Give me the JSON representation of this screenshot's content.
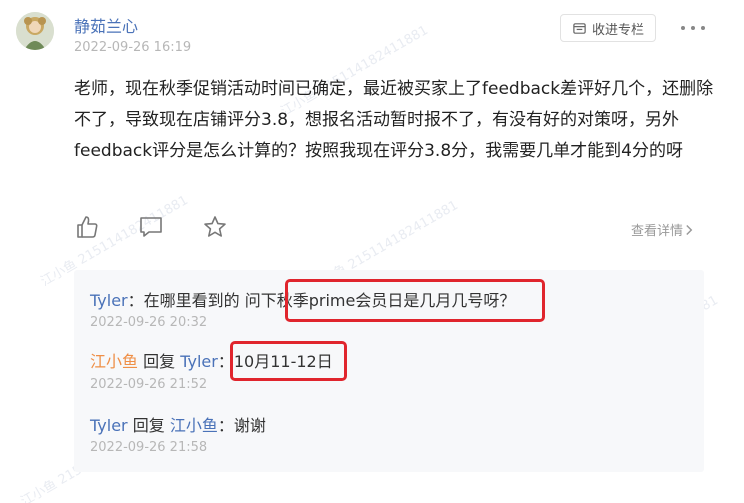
{
  "post": {
    "author": "静茹兰心",
    "time": "2022-09-26 16:19",
    "text": "老师，现在秋季促销活动时间已确定，最近被买家上了feedback差评好几个，还删除不了，导致现在店铺评分3.8，想报名活动暂时报不了，有没有好的对策呀，另外feedback评分是怎么计算的？按照我现在评分3.8分，我需要几单才能到4分的呀"
  },
  "header": {
    "collect_label": "收进专栏"
  },
  "actions": {
    "detail_label": "查看详情"
  },
  "comments": [
    {
      "user": "Tyler",
      "reply_word": "",
      "reply_to": "",
      "sep": "：",
      "text": "在哪里看到的 问下秋季prime会员日是几月几号呀？",
      "time": "2022-09-26 20:32"
    },
    {
      "user": "江小鱼",
      "reply_word": "回复",
      "reply_to": "Tyler",
      "sep": "：",
      "text": "10月11-12日",
      "time": "2022-09-26 21:52"
    },
    {
      "user": "Tyler",
      "reply_word": "回复",
      "reply_to": "江小鱼",
      "sep": "：",
      "text": "谢谢",
      "time": "2022-09-26 21:58"
    }
  ],
  "watermark": "江小鱼 2151141824118​81",
  "colors": {
    "link_blue": "#4a72b8",
    "accent_orange": "#ef8f47",
    "highlight_red": "#e0252d"
  },
  "icons": [
    "avatar-image",
    "collect-icon",
    "more-icon",
    "like-icon",
    "comment-icon",
    "star-icon",
    "chevron-right-icon"
  ]
}
